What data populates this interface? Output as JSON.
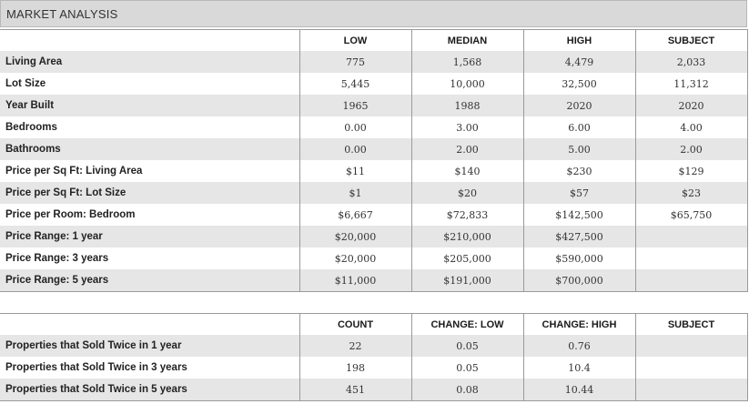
{
  "title": "MARKET ANALYSIS",
  "analysis": {
    "headers": [
      "",
      "LOW",
      "MEDIAN",
      "HIGH",
      "SUBJECT"
    ],
    "rows": [
      {
        "label": "Living Area",
        "values": [
          "775",
          "1,568",
          "4,479",
          "2,033"
        ]
      },
      {
        "label": "Lot Size",
        "values": [
          "5,445",
          "10,000",
          "32,500",
          "11,312"
        ]
      },
      {
        "label": "Year Built",
        "values": [
          "1965",
          "1988",
          "2020",
          "2020"
        ]
      },
      {
        "label": "Bedrooms",
        "values": [
          "0.00",
          "3.00",
          "6.00",
          "4.00"
        ]
      },
      {
        "label": "Bathrooms",
        "values": [
          "0.00",
          "2.00",
          "5.00",
          "2.00"
        ]
      },
      {
        "label": "Price per Sq Ft: Living Area",
        "values": [
          "$11",
          "$140",
          "$230",
          "$129"
        ]
      },
      {
        "label": "Price per Sq Ft: Lot Size",
        "values": [
          "$1",
          "$20",
          "$57",
          "$23"
        ]
      },
      {
        "label": "Price per Room: Bedroom",
        "values": [
          "$6,667",
          "$72,833",
          "$142,500",
          "$65,750"
        ]
      },
      {
        "label": "Price Range: 1 year",
        "values": [
          "$20,000",
          "$210,000",
          "$427,500",
          ""
        ]
      },
      {
        "label": "Price Range: 3 years",
        "values": [
          "$20,000",
          "$205,000",
          "$590,000",
          ""
        ]
      },
      {
        "label": "Price Range: 5 years",
        "values": [
          "$11,000",
          "$191,000",
          "$700,000",
          ""
        ]
      }
    ]
  },
  "sold_twice": {
    "headers": [
      "",
      "COUNT",
      "CHANGE: LOW",
      "CHANGE: HIGH",
      "SUBJECT"
    ],
    "rows": [
      {
        "label": "Properties that Sold Twice in 1 year",
        "values": [
          "22",
          "0.05",
          "0.76",
          ""
        ]
      },
      {
        "label": "Properties that Sold Twice in 3 years",
        "values": [
          "198",
          "0.05",
          "10.4",
          ""
        ]
      },
      {
        "label": "Properties that Sold Twice in 5 years",
        "values": [
          "451",
          "0.08",
          "10.44",
          ""
        ]
      }
    ]
  }
}
